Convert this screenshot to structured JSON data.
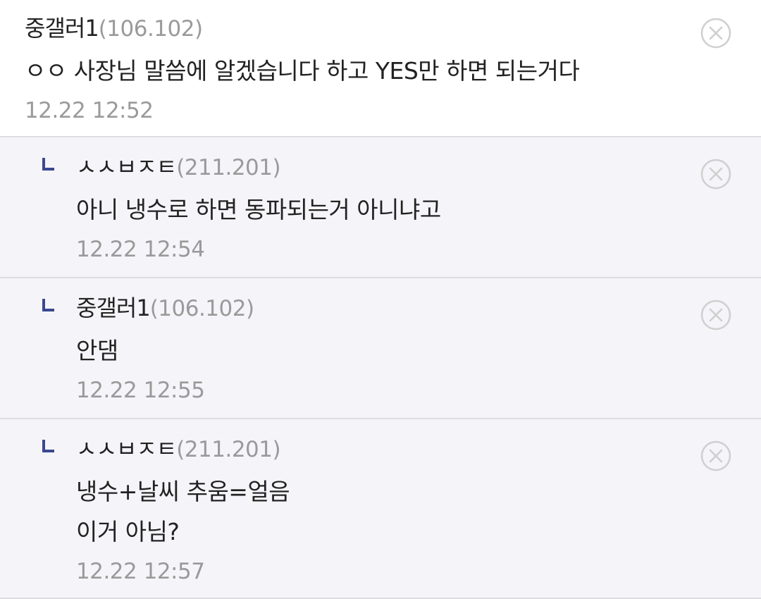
{
  "comments": [
    {
      "nick": "중갤러1",
      "ip": "(106.102)",
      "text": "ㅇㅇ 사장님 말씀에 알겠습니다 하고 YES만 하면 되는거다",
      "time": "12.22 12:52"
    },
    {
      "nick": "ㅅㅅㅂㅈㅌ",
      "ip": "(211.201)",
      "text": "아니 냉수로 하면 동파되는거 아니냐고",
      "time": "12.22 12:54"
    },
    {
      "nick": "중갤러1",
      "ip": "(106.102)",
      "text": "안댐",
      "time": "12.22 12:55"
    },
    {
      "nick": "ㅅㅅㅂㅈㅌ",
      "ip": "(211.201)",
      "text": "냉수+날씨 추움=얼음\n이거 아님?",
      "time": "12.22 12:57"
    }
  ],
  "colors": {
    "reply_background": "#f5f5f9",
    "reply_mark": "#3b4890",
    "meta_gray": "#9a9a9a",
    "delete_icon": "#d0d0d0"
  },
  "icons": {
    "delete": "close-circle-icon",
    "reply": "reply-arrow-icon"
  }
}
